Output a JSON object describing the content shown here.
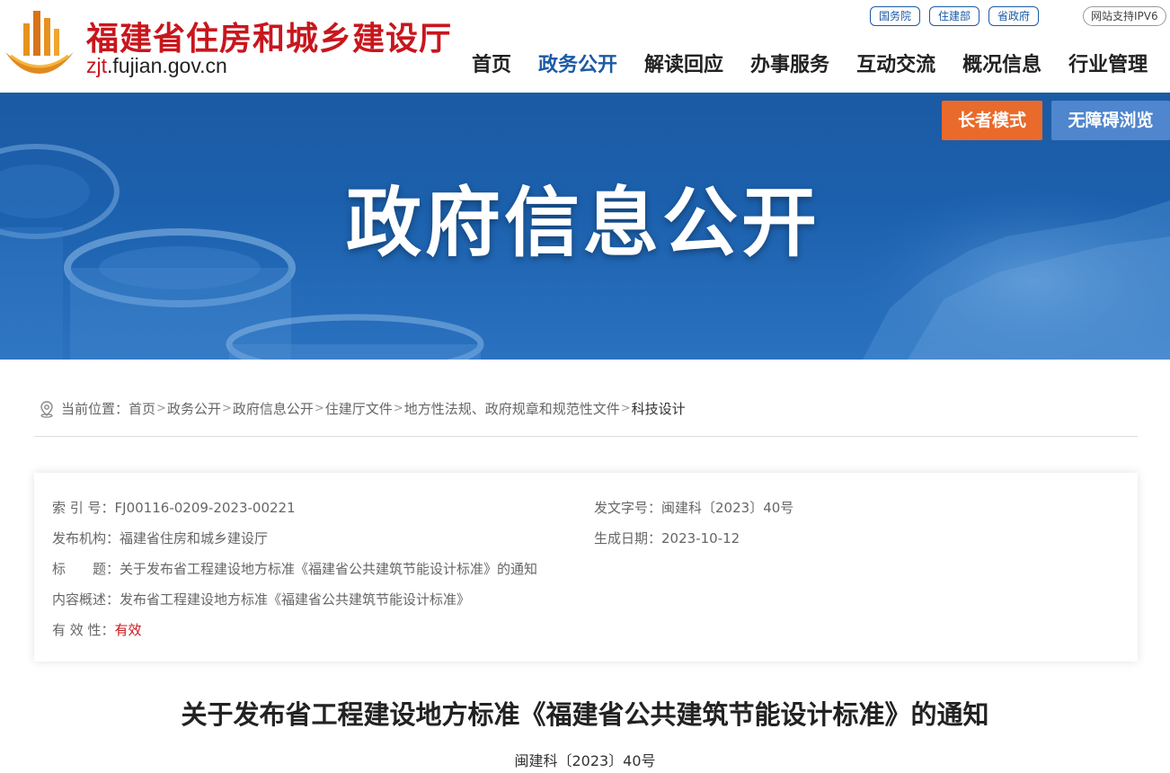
{
  "header": {
    "site_name": "福建省住房和城乡建设厅",
    "domain_highlight": "zjt",
    "domain_rest": ".fujian.gov.cn",
    "logo_icon": "building-logo-icon",
    "top_links": [
      "国务院",
      "住建部",
      "省政府"
    ],
    "ipv6_label": "网站支持IPV6",
    "nav": [
      "首页",
      "政务公开",
      "解读回应",
      "办事服务",
      "互动交流",
      "概况信息",
      "行业管理"
    ],
    "nav_active_index": 1
  },
  "banner": {
    "title": "政府信息公开",
    "elder_mode": "长者模式",
    "accessible": "无障碍浏览"
  },
  "breadcrumb": {
    "prefix": "当前位置：",
    "items": [
      "首页",
      "政务公开",
      "政府信息公开",
      "住建厅文件",
      "地方性法规、政府规章和规范性文件",
      "科技设计"
    ],
    "separator": ">"
  },
  "meta": {
    "index_label": "索 引 号：",
    "index_value": "FJ00116-0209-2023-00221",
    "doc_no_label": "发文字号：",
    "doc_no_value": "闽建科〔2023〕40号",
    "publisher_label": "发布机构：",
    "publisher_value": "福建省住房和城乡建设厅",
    "date_label": "生成日期：",
    "date_value": "2023-10-12",
    "title_label": "标　　题：",
    "title_value": "关于发布省工程建设地方标准《福建省公共建筑节能设计标准》的通知",
    "summary_label": "内容概述：",
    "summary_value": "发布省工程建设地方标准《福建省公共建筑节能设计标准》",
    "validity_label": "有 效 性：",
    "validity_value": "有效"
  },
  "article": {
    "title": "关于发布省工程建设地方标准《福建省公共建筑节能设计标准》的通知",
    "doc_no": "闽建科〔2023〕40号"
  },
  "colors": {
    "brand_red": "#c8161d",
    "brand_blue": "#1c5aa6",
    "elder_orange": "#e96a2a",
    "access_blue": "#4f86cd"
  }
}
